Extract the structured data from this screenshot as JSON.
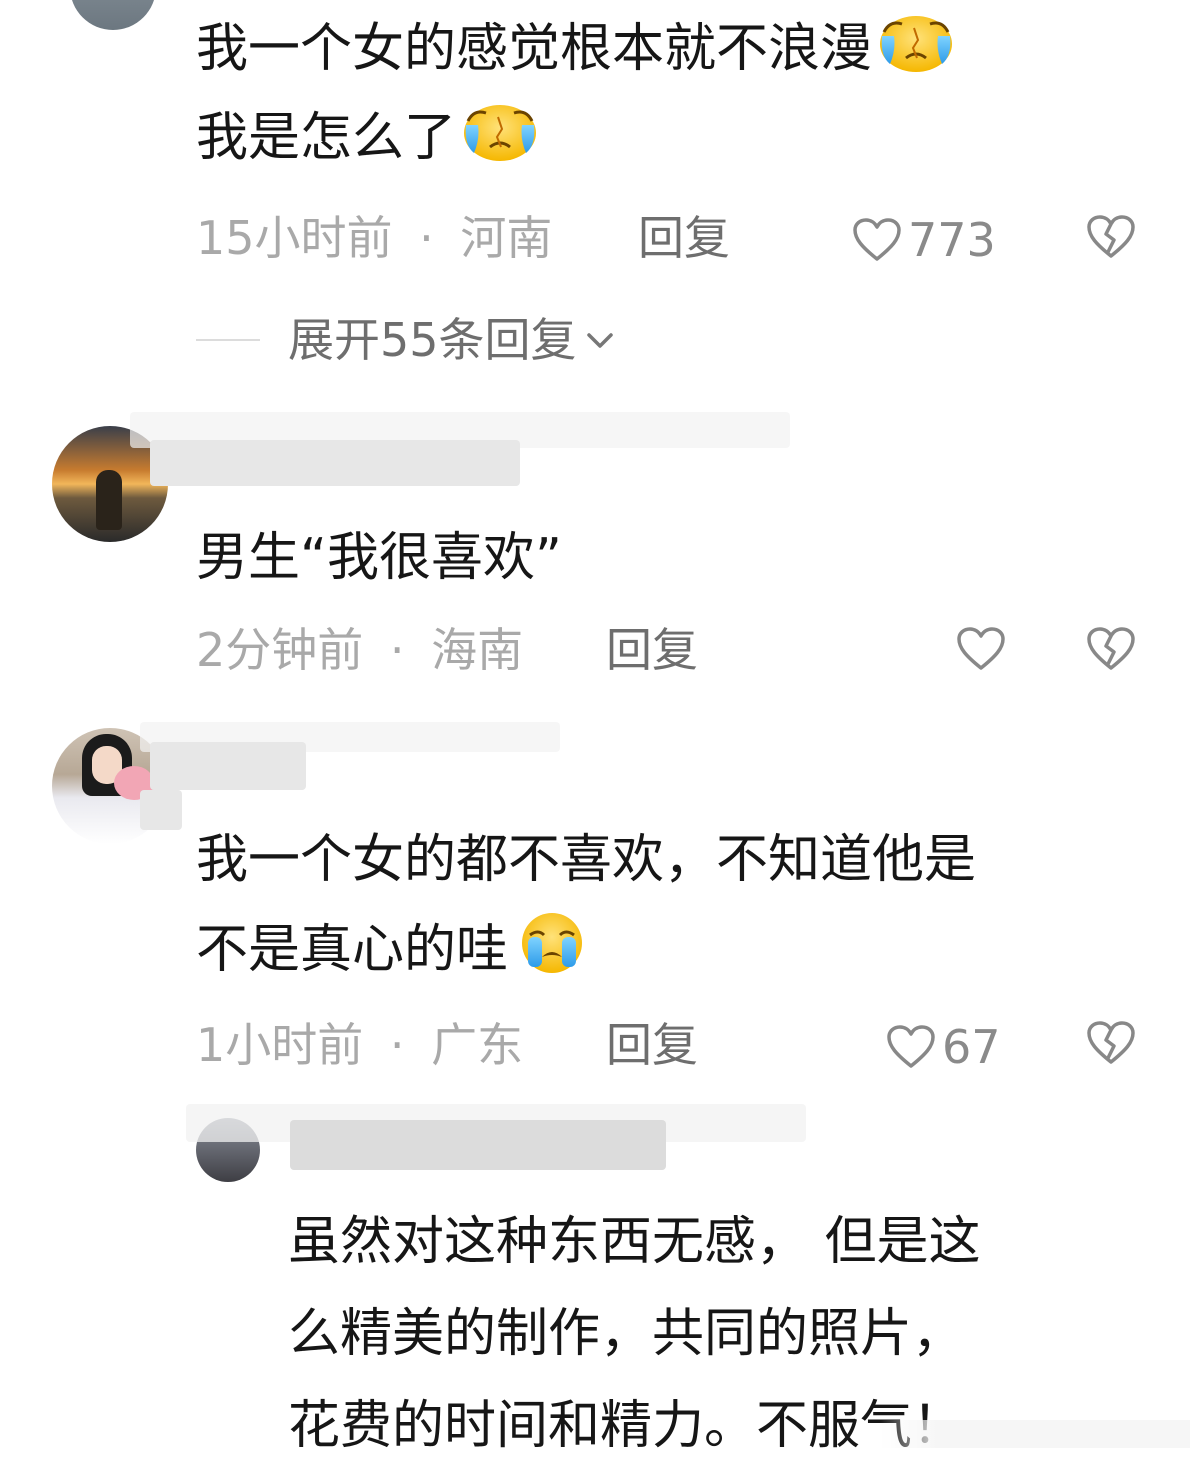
{
  "comments": [
    {
      "text_lines": [
        "我一个女的感觉根本就不浪漫",
        "我是怎么了"
      ],
      "time": "15小时前",
      "location": "河南",
      "reply_label": "回复",
      "likes": "773",
      "expand_label": "展开55条回复"
    },
    {
      "text_lines": [
        "男生“我很喜欢”"
      ],
      "time": "2分钟前",
      "location": "海南",
      "reply_label": "回复",
      "likes": ""
    },
    {
      "text_lines": [
        "我一个女的都不喜欢，不知道他是",
        "不是真心的哇"
      ],
      "time": "1小时前",
      "location": "广东",
      "reply_label": "回复",
      "likes": "67"
    }
  ],
  "reply": {
    "text_lines": [
      "虽然对这种东西无感，  但是这",
      "么精美的制作，共同的照片，",
      "花费的时间和精力。不服气！"
    ]
  },
  "separator": "·",
  "icons": {
    "like": "heart-outline-icon",
    "dislike": "broken-heart-icon",
    "expand": "chevron-down-icon",
    "emoji_sad": "crying-face-emoji"
  },
  "colors": {
    "text": "#161616",
    "meta": "#a9a9a9",
    "reply": "#6e6e6e",
    "icon": "#888888"
  }
}
